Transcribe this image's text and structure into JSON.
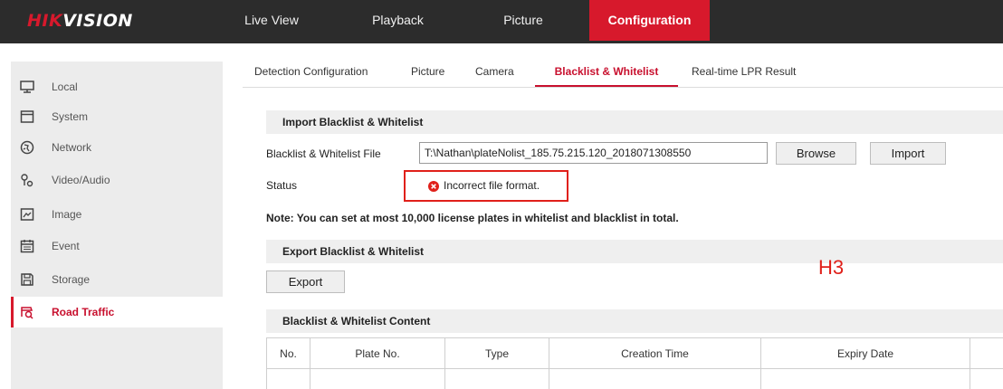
{
  "header": {
    "logo_red": "HIK",
    "logo_white": "VISION",
    "nav": [
      {
        "label": "Live View"
      },
      {
        "label": "Playback"
      },
      {
        "label": "Picture"
      },
      {
        "label": "Configuration",
        "active": true
      }
    ]
  },
  "sidebar": {
    "items": [
      {
        "label": "Local",
        "icon": "monitor-icon"
      },
      {
        "label": "System",
        "icon": "system-icon"
      },
      {
        "label": "Network",
        "icon": "globe-icon"
      },
      {
        "label": "Video/Audio",
        "icon": "video-audio-icon"
      },
      {
        "label": "Image",
        "icon": "image-icon"
      },
      {
        "label": "Event",
        "icon": "calendar-icon"
      },
      {
        "label": "Storage",
        "icon": "save-icon"
      },
      {
        "label": "Road Traffic",
        "icon": "road-traffic-icon",
        "active": true
      }
    ]
  },
  "tabs": [
    {
      "label": "Detection Configuration"
    },
    {
      "label": "Picture"
    },
    {
      "label": "Camera"
    },
    {
      "label": "Blacklist & Whitelist",
      "active": true
    },
    {
      "label": "Real-time LPR Result"
    }
  ],
  "import_section": {
    "title": "Import Blacklist & Whitelist",
    "file_label": "Blacklist & Whitelist File",
    "file_value": "T:\\Nathan\\plateNolist_185.75.215.120_2018071308550",
    "browse_label": "Browse",
    "import_label": "Import",
    "status_label": "Status",
    "status_message": "Incorrect file format.",
    "note": "Note: You can set at most 10,000 license plates in whitelist and blacklist in total."
  },
  "export_section": {
    "title": "Export Blacklist & Whitelist",
    "export_label": "Export"
  },
  "annotation": "H3",
  "content_section": {
    "title": "Blacklist & Whitelist Content",
    "columns": [
      "No.",
      "Plate No.",
      "Type",
      "Creation Time",
      "Expiry Date",
      ""
    ]
  },
  "colors": {
    "accent": "#d7192c",
    "topbar": "#2c2c2c",
    "error": "#e0201a"
  }
}
